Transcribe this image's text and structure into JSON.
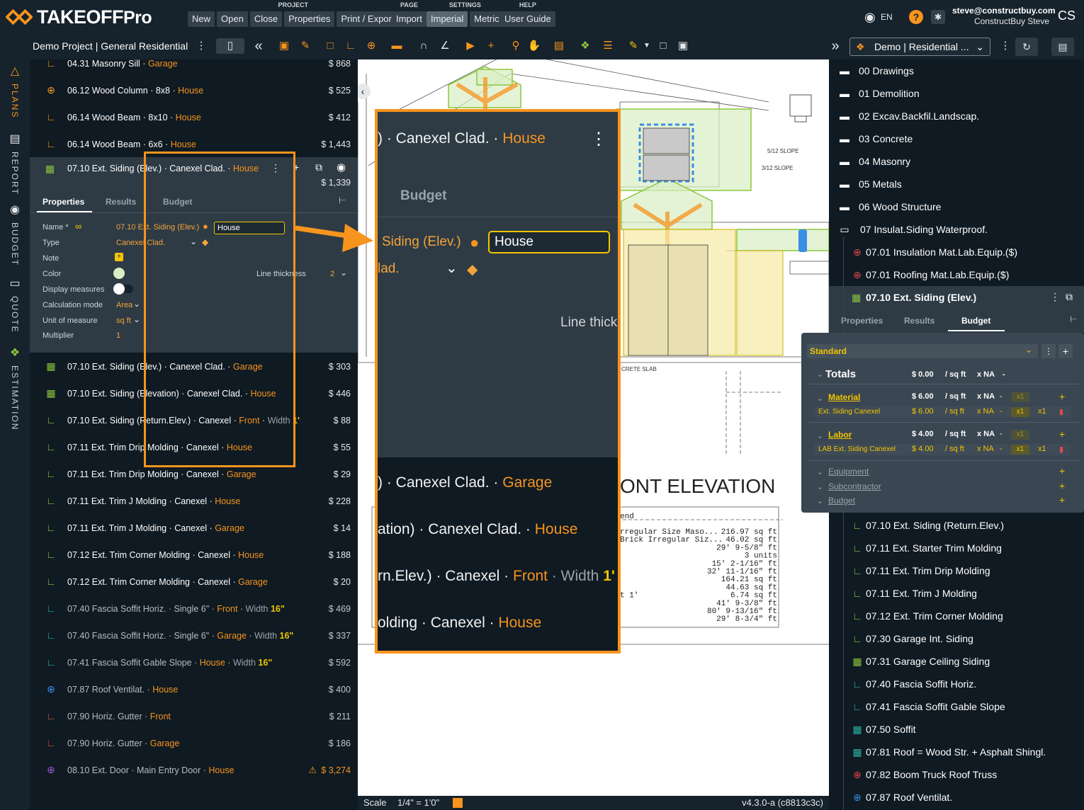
{
  "app": {
    "logo_main": "TAKEOFF",
    "logo_sub": "Pro"
  },
  "menu": {
    "project": {
      "label": "PROJECT",
      "buttons": [
        "New",
        "Open",
        "Close",
        "Properties",
        "Print / Export"
      ]
    },
    "page": {
      "label": "PAGE",
      "buttons": [
        "Import"
      ]
    },
    "settings": {
      "label": "SETTINGS",
      "buttons": [
        "Imperial",
        "Metric"
      ]
    },
    "help": {
      "label": "HELP",
      "buttons": [
        "User Guide"
      ]
    }
  },
  "user": {
    "lang": "EN",
    "email": "steve@constructbuy.com",
    "name": "ConstructBuy Steve",
    "initials": "CS"
  },
  "toolbar": {
    "project_title": "Demo Project | General Residential",
    "project_select": "Demo | Residential ..."
  },
  "rail": [
    {
      "label": "PLANS",
      "icon": "plans-icon"
    },
    {
      "label": "REPORT",
      "icon": "report-icon"
    },
    {
      "label": "BUDGET",
      "icon": "budget-icon"
    },
    {
      "label": "QUOTE",
      "icon": "quote-icon"
    },
    {
      "label": "ESTIMATION",
      "icon": "estimation-icon"
    }
  ],
  "left_list_top": [
    {
      "code": "04.31 Masonry Sill",
      "p1": "Garage",
      "p2": "",
      "price": "$ 868",
      "icon": "polyline-icon",
      "color": "#f7941d"
    },
    {
      "code": "06.12 Wood Column",
      "p1": "8x8",
      "p2": "House",
      "price": "$ 525",
      "icon": "target-icon",
      "color": "#f7941d"
    },
    {
      "code": "06.14 Wood Beam",
      "p1": "8x10",
      "p2": "House",
      "price": "$ 412",
      "icon": "polyline-icon",
      "color": "#f7941d"
    },
    {
      "code": "06.14 Wood Beam",
      "p1": "6x6",
      "p2": "House",
      "price": "$ 1,443",
      "icon": "polyline-icon",
      "color": "#f7941d"
    }
  ],
  "selected": {
    "code": "07.10 Ext. Siding (Elev.)",
    "type": "Canexel Clad.",
    "loc": "House",
    "price": "$ 1,339",
    "tabs": [
      "Properties",
      "Results",
      "Budget"
    ],
    "props": {
      "name_label": "Name *",
      "name_value": "07.10 Ext. Siding (Elev.)",
      "name_input": "House",
      "type_label": "Type",
      "type_value": "Canexel Clad.",
      "note_label": "Note",
      "color_label": "Color",
      "line_thickness_label": "Line thickness",
      "line_thickness_value": "2",
      "display_label": "Display measures",
      "calc_label": "Calculation mode",
      "calc_value": "Area",
      "unit_label": "Unit of measure",
      "unit_value": "sq ft",
      "mult_label": "Multiplier",
      "mult_value": "1"
    }
  },
  "left_list_bottom": [
    {
      "code": "07.10 Ext. Siding (Elev.)",
      "t": "Canexel Clad.",
      "l": "Garage",
      "w": "",
      "wv": "",
      "price": "$ 303",
      "icon": "area-icon",
      "color": "#8dc63f",
      "faded": false
    },
    {
      "code": "07.10 Ext. Siding (Elevation)",
      "t": "Canexel Clad.",
      "l": "House",
      "w": "",
      "wv": "",
      "price": "$ 446",
      "icon": "area-icon",
      "color": "#8dc63f",
      "faded": false
    },
    {
      "code": "07.10 Ext. Siding (Return.Elev.)",
      "t": "Canexel",
      "l": "Front",
      "w": "Width",
      "wv": "1'",
      "price": "$ 88",
      "icon": "polyline-icon",
      "color": "#8dc63f",
      "faded": false
    },
    {
      "code": "07.11 Ext. Trim Drip Molding",
      "t": "Canexel",
      "l": "House",
      "w": "",
      "wv": "",
      "price": "$ 55",
      "icon": "polyline-icon",
      "color": "#8dc63f",
      "faded": false
    },
    {
      "code": "07.11 Ext. Trim Drip Molding",
      "t": "Canexel",
      "l": "Garage",
      "w": "",
      "wv": "",
      "price": "$ 29",
      "icon": "polyline-icon",
      "color": "#8dc63f",
      "faded": false
    },
    {
      "code": "07.11 Ext. Trim J Molding",
      "t": "Canexel",
      "l": "House",
      "w": "",
      "wv": "",
      "price": "$ 228",
      "icon": "polyline-icon",
      "color": "#8dc63f",
      "faded": false
    },
    {
      "code": "07.11 Ext. Trim J Molding",
      "t": "Canexel",
      "l": "Garage",
      "w": "",
      "wv": "",
      "price": "$ 14",
      "icon": "polyline-icon",
      "color": "#8dc63f",
      "faded": false
    },
    {
      "code": "07.12 Ext. Trim Corner Molding",
      "t": "Canexel",
      "l": "House",
      "w": "",
      "wv": "",
      "price": "$ 188",
      "icon": "polyline-icon",
      "color": "#8dc63f",
      "faded": false
    },
    {
      "code": "07.12 Ext. Trim Corner Molding",
      "t": "Canexel",
      "l": "Garage",
      "w": "",
      "wv": "",
      "price": "$ 20",
      "icon": "polyline-icon",
      "color": "#8dc63f",
      "faded": false
    },
    {
      "code": "07.40 Fascia Soffit Horiz.",
      "t": "Single 6\"",
      "l": "Front",
      "w": "Width",
      "wv": "16\"",
      "price": "$ 469",
      "icon": "polyline-icon",
      "color": "#2bb3a3",
      "faded": true
    },
    {
      "code": "07.40 Fascia Soffit Horiz.",
      "t": "Single 6\"",
      "l": "Garage",
      "w": "Width",
      "wv": "16\"",
      "price": "$ 337",
      "icon": "polyline-icon",
      "color": "#2bb3a3",
      "faded": true
    },
    {
      "code": "07.41 Fascia Soffit Gable Slope",
      "t": "",
      "l": "House",
      "w": "Width",
      "wv": "16\"",
      "price": "$ 592",
      "icon": "polyline-icon",
      "color": "#2bb3a3",
      "faded": true
    },
    {
      "code": "07.87 Roof Ventilat.",
      "t": "",
      "l": "House",
      "w": "",
      "wv": "",
      "price": "$ 400",
      "icon": "target-icon",
      "color": "#3a8ee6",
      "faded": true
    },
    {
      "code": "07.90 Horiz. Gutter",
      "t": "",
      "l": "Front",
      "w": "",
      "wv": "",
      "price": "$ 211",
      "icon": "polyline-icon",
      "color": "#e04848",
      "faded": true
    },
    {
      "code": "07.90 Horiz. Gutter",
      "t": "",
      "l": "Garage",
      "w": "",
      "wv": "",
      "price": "$ 186",
      "icon": "polyline-icon",
      "color": "#e04848",
      "faded": true
    },
    {
      "code": "08.10 Ext. Door",
      "t": "Main Entry Door",
      "l": "House",
      "w": "",
      "wv": "",
      "price": "$ 3,274",
      "icon": "target-icon",
      "color": "#9b59d0",
      "faded": true,
      "warn": true
    }
  ],
  "zoom": {
    "l1a": ") · Canexel Clad. · ",
    "l1b": "House",
    "budget_tab": "Budget",
    "l2a": "Siding (Elev.)",
    "l2input": "House",
    "l3": "lad.",
    "l4": "Line thick",
    "r1a": ") · Canexel Clad. · ",
    "r1b": "Garage",
    "r2a": "ation) · Canexel Clad. · ",
    "r2b": "House",
    "r3a": "rn.Elev.) · Canexel · ",
    "r3b": "Front",
    "r3c": " · Width ",
    "r3d": "1'",
    "r4a": "olding · Canexel · ",
    "r4b": "House"
  },
  "drawing": {
    "title": "ONT ELEVATION",
    "slope1": "5/12 SLOPE",
    "slope2": "3/12 SLOPE",
    "slab": "CRETE SLAB",
    "legend_title": "end",
    "legend_rows": [
      {
        "name": "rregular Size Maso...",
        "val": "216.97 sq ft"
      },
      {
        "name": "Brick Irregular Siz...",
        "val": "46.02 sq ft"
      },
      {
        "name": "",
        "val": "29' 9-5/8\" ft"
      },
      {
        "name": "",
        "val": "3 units"
      },
      {
        "name": "",
        "val": "15' 2-1/16\" ft"
      },
      {
        "name": "",
        "val": "32' 11-1/16\" ft"
      },
      {
        "name": "",
        "val": "164.21 sq ft"
      },
      {
        "name": "",
        "val": "44.63 sq ft"
      },
      {
        "name": "t 1'",
        "val": "6.74 sq ft"
      },
      {
        "name": "",
        "val": "41' 9-3/8\" ft"
      },
      {
        "name": "",
        "val": "80' 9-13/16\" ft"
      },
      {
        "name": "",
        "val": "29' 8-3/4\" ft"
      }
    ]
  },
  "status": {
    "scale_label": "Scale",
    "scale_value": "1/4\" = 1'0\"",
    "version": "v4.3.0-a  (c8813c3c)"
  },
  "right_folders": [
    "00 Drawings",
    "01 Demolition",
    "02 Excav.Backfil.Landscap.",
    "03 Concrete",
    "04 Masonry",
    "05 Metals",
    "06 Wood Structure",
    "07 Insulat.Siding Waterproof."
  ],
  "right_items_top": [
    {
      "label": "07.01 Insulation Mat.Lab.Equip.($)",
      "icon": "target-icon",
      "color": "#e04848"
    },
    {
      "label": "07.01 Roofing Mat.Lab.Equip.($)",
      "icon": "target-icon",
      "color": "#e04848"
    }
  ],
  "right_selected": {
    "label": "07.10 Ext. Siding (Elev.)",
    "tabs": [
      "Properties",
      "Results",
      "Budget"
    ]
  },
  "budget": {
    "template": "Standard",
    "totals_label": "Totals",
    "totals_price": "$ 0.00",
    "totals_unit": "/ sq ft",
    "totals_x": "x NA",
    "totals_dash": "-",
    "material_label": "Material",
    "material_price": "$ 6.00",
    "material_unit": "/ sq ft",
    "material_x": "x NA",
    "material_dash": "-",
    "material_badge": "x1",
    "material_item": "Ext. Siding Canexel",
    "material_item_price": "$ 6.00",
    "material_item_unit": "/ sq ft",
    "material_item_x": "x NA",
    "material_item_dash": "-",
    "material_item_badge": "x1",
    "material_item_mult": "x1",
    "labor_label": "Labor",
    "labor_price": "$ 4.00",
    "labor_unit": "/ sq ft",
    "labor_x": "x NA",
    "labor_dash": "-",
    "labor_badge": "x1",
    "labor_item": "LAB Ext. Siding Canexel",
    "labor_item_price": "$ 4.00",
    "labor_item_unit": "/ sq ft",
    "labor_item_x": "x NA",
    "labor_item_dash": "-",
    "labor_item_badge": "x1",
    "labor_item_mult": "x1",
    "equipment_label": "Equipment",
    "subcontractor_label": "Subcontractor",
    "budget_label": "Budget"
  },
  "right_items_bottom": [
    {
      "label": "07.10 Ext. Siding (Return.Elev.)",
      "icon": "polyline-icon",
      "color": "#8dc63f"
    },
    {
      "label": "07.11 Ext. Starter Trim Molding",
      "icon": "polyline-icon",
      "color": "#8dc63f"
    },
    {
      "label": "07.11 Ext. Trim Drip Molding",
      "icon": "polyline-icon",
      "color": "#8dc63f"
    },
    {
      "label": "07.11 Ext. Trim J Molding",
      "icon": "polyline-icon",
      "color": "#8dc63f"
    },
    {
      "label": "07.12 Ext. Trim Corner Molding",
      "icon": "polyline-icon",
      "color": "#8dc63f"
    },
    {
      "label": "07.30 Garage Int. Siding",
      "icon": "polyline-icon",
      "color": "#8dc63f"
    },
    {
      "label": "07.31 Garage Ceiling Siding",
      "icon": "area-icon",
      "color": "#8dc63f"
    },
    {
      "label": "07.40 Fascia Soffit Horiz.",
      "icon": "polyline-icon",
      "color": "#2bb3a3"
    },
    {
      "label": "07.41 Fascia Soffit Gable Slope",
      "icon": "polyline-icon",
      "color": "#2bb3a3"
    },
    {
      "label": "07.50 Soffit",
      "icon": "area-icon",
      "color": "#2bb3a3"
    },
    {
      "label": "07.81 Roof = Wood Str. + Asphalt Shingl.",
      "icon": "area-icon",
      "color": "#2bb3a3"
    },
    {
      "label": "07.82 Boom Truck Roof Truss",
      "icon": "target-icon",
      "color": "#e04848"
    },
    {
      "label": "07.87 Roof Ventilat.",
      "icon": "target-icon",
      "color": "#3a8ee6"
    }
  ]
}
